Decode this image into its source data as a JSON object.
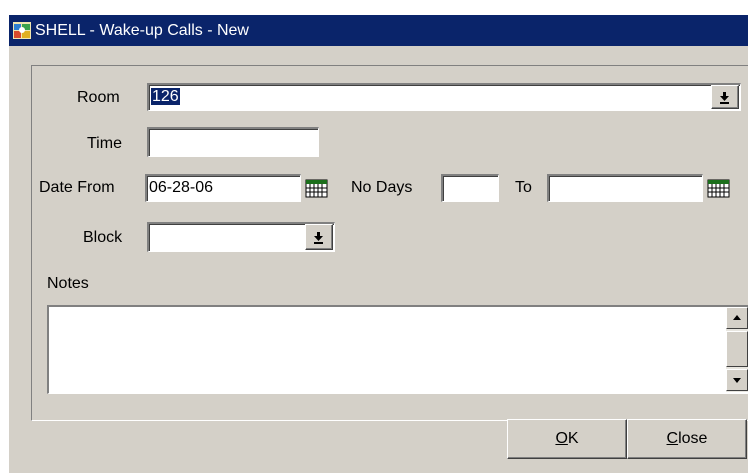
{
  "window": {
    "title": "SHELL - Wake-up Calls - New"
  },
  "form": {
    "room": {
      "label": "Room",
      "value": "126"
    },
    "time": {
      "label": "Time",
      "value": ""
    },
    "date_from": {
      "label": "Date From",
      "value": "06-28-06"
    },
    "no_days": {
      "label": "No Days",
      "value": ""
    },
    "to": {
      "label": "To",
      "value": ""
    },
    "block": {
      "label": "Block",
      "value": ""
    },
    "notes": {
      "label": "Notes",
      "value": ""
    }
  },
  "buttons": {
    "ok": {
      "mnemonic": "O",
      "rest": "K"
    },
    "close": {
      "mnemonic": "C",
      "rest": "lose"
    }
  },
  "icons": {
    "room_dropdown": "dropdown-arrow-icon",
    "block_dropdown": "dropdown-arrow-icon",
    "date_from_calendar": "calendar-icon",
    "to_calendar": "calendar-icon",
    "app": "app-icon"
  },
  "colors": {
    "titlebar": "#0a246a",
    "dialog": "#d4d0c8",
    "selection": "#0a246a"
  }
}
